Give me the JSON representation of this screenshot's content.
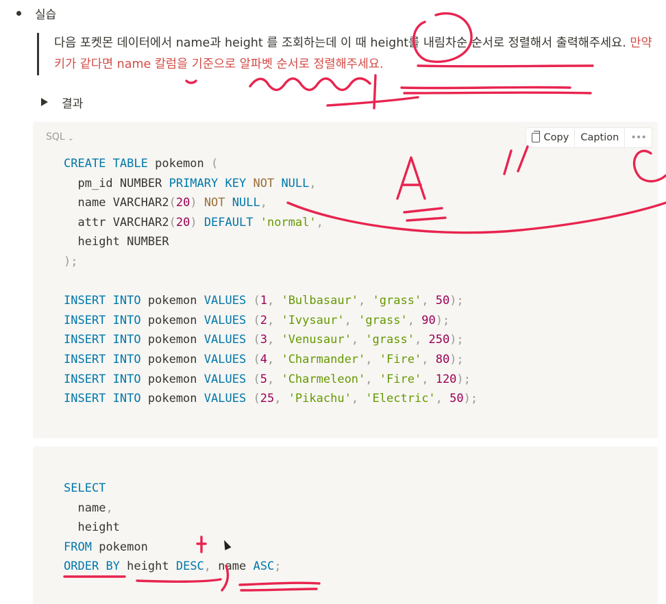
{
  "heading": "실습",
  "quote": {
    "text_black": "다음 포켓몬 데이터에서 name과 height 를 조회하는데 이 때 height를 내림차순 순서로 정렬해서 출력해주세요. ",
    "text_red": "만약 키가 같다면 name 칼럼을 기준으로 알파벳 순서로 정렬해주세요."
  },
  "toggle_label": "결과",
  "code_block_1": {
    "language": "SQL",
    "copy_label": "Copy",
    "caption_label": "Caption",
    "more_label": "•••",
    "create": [
      "CREATE",
      "TABLE",
      "pokemon",
      "(",
      "pm_id",
      "NUMBER",
      "PRIMARY",
      "KEY",
      "NOT",
      "NULL",
      "name",
      "VARCHAR2",
      "20",
      "attr",
      "DEFAULT",
      "'normal'",
      "height"
    ],
    "insert_kw": [
      "INSERT",
      "INTO",
      "pokemon",
      "VALUES"
    ],
    "rows": [
      {
        "id": "1",
        "name": "'Bulbasaur'",
        "attr": "'grass'",
        "height": "50"
      },
      {
        "id": "2",
        "name": "'Ivysaur'",
        "attr": "'grass'",
        "height": "90"
      },
      {
        "id": "3",
        "name": "'Venusaur'",
        "attr": "'grass'",
        "height": "250"
      },
      {
        "id": "4",
        "name": "'Charmander'",
        "attr": "'Fire'",
        "height": "80"
      },
      {
        "id": "5",
        "name": "'Charmeleon'",
        "attr": "'Fire'",
        "height": "120"
      },
      {
        "id": "25",
        "name": "'Pikachu'",
        "attr": "'Electric'",
        "height": "50"
      }
    ]
  },
  "code_block_2": {
    "select": "SELECT",
    "col1": "name",
    "col2": "height",
    "from": "FROM",
    "table": "pokemon",
    "order": "ORDER",
    "by": "BY",
    "sort1": "height",
    "desc": "DESC",
    "sort2": "name",
    "asc": "ASC"
  },
  "colors": {
    "keyword": "#0077aa",
    "string": "#669900",
    "number": "#990055",
    "annotation": "#e8244f",
    "highlight_red": "#d44c47"
  }
}
